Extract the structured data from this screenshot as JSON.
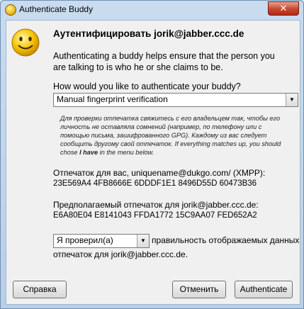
{
  "window": {
    "title": "Authenticate Buddy",
    "close_label": "✕"
  },
  "header": {
    "heading": "Аутентифицировать jorik@jabber.ccc.de"
  },
  "description": "Authenticating a buddy helps ensure that the person you are talking to is who he or she claims to be.",
  "question": "How would you like to authenticate your buddy?",
  "method_select": {
    "value": "Manual fingerprint verification",
    "arrow": "▼"
  },
  "help": {
    "part1": "Для проверки отпечатка свяжитесь с его владельцем так, чтобы его личность не оставляла сомнений (например, по телефону или с помощью письма, зашифрованного GPG). Каждому из вас следует сообщить другому свой отпечаток. If everything matches up, you should chose ",
    "bold": "I have",
    "part2": " in the menu below."
  },
  "your_fp": {
    "label": "Отпечаток для вас, uniquename@dukgo.com/ (XMPP):",
    "value": "23E569A4 4FB8666E 6DDDF1E1 8496D55D 60473B36"
  },
  "their_fp": {
    "label": "Предполагаемый отпечаток для jorik@jabber.ccc.de:",
    "value": "E6A80E04 E8141043 FFDA1772 15C9AA07 FED652A2"
  },
  "verify": {
    "select_value": "Я проверил(а)",
    "arrow": "▼",
    "text_line1": "правильность отображаемых данных",
    "text_line2": "отпечаток для jorik@jabber.ccc.de."
  },
  "buttons": {
    "help": "Справка",
    "cancel": "Отменить",
    "authenticate": "Authenticate"
  }
}
